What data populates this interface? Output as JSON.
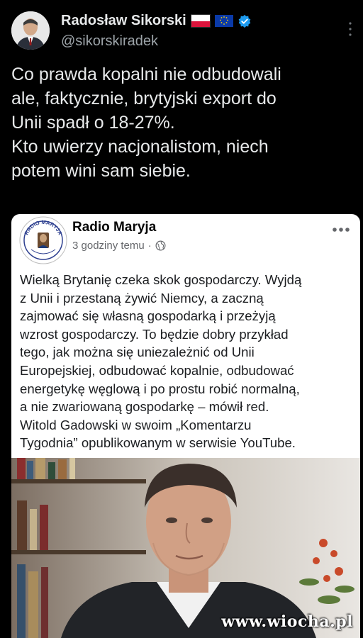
{
  "tweet": {
    "author_name": "Radosław Sikorski",
    "author_handle": "@sikorskiradek",
    "flags": [
      "poland-flag",
      "eu-flag"
    ],
    "verified": true,
    "text_lines": [
      "Co prawda kopalni nie odbudowali",
      "ale, faktycznie, brytyjski export do",
      "Unii spadł o 18-27%.",
      "Kto uwierzy nacjonalistom, niech",
      "potem wini sam siebie."
    ]
  },
  "embedded_post": {
    "page_name": "Radio Maryja",
    "logo_text": "RADIO MARYJA",
    "time_ago": "3 godziny temu",
    "separator": "·",
    "visibility_icon": "globe-icon",
    "text_lines": [
      "Wielką Brytanię czeka skok gospodarczy. Wyjdą",
      "z Unii i przestaną żywić Niemcy, a zaczną",
      "zajmować się własną gospodarką i przeżyją",
      "wzrost gospodarczy. To będzie dobry przykład",
      "tego, jak można się uniezależnić od Unii",
      "Europejskiej, odbudować kopalnie, odbudować",
      "energetykę węglową i po prostu robić normalną,",
      "a nie zwariowaną gospodarkę – mówił red.",
      "Witold Gadowski w swoim „Komentarzu",
      "Tygodnia” opublikowanym w serwisie YouTube."
    ]
  },
  "watermark": "www.wiocha.pl",
  "colors": {
    "background": "#000000",
    "text_primary": "#e7e9ea",
    "text_secondary": "#9ca3a8",
    "verified": "#1d9bf0",
    "card_bg": "#ffffff",
    "fb_text": "#1c1e21"
  }
}
